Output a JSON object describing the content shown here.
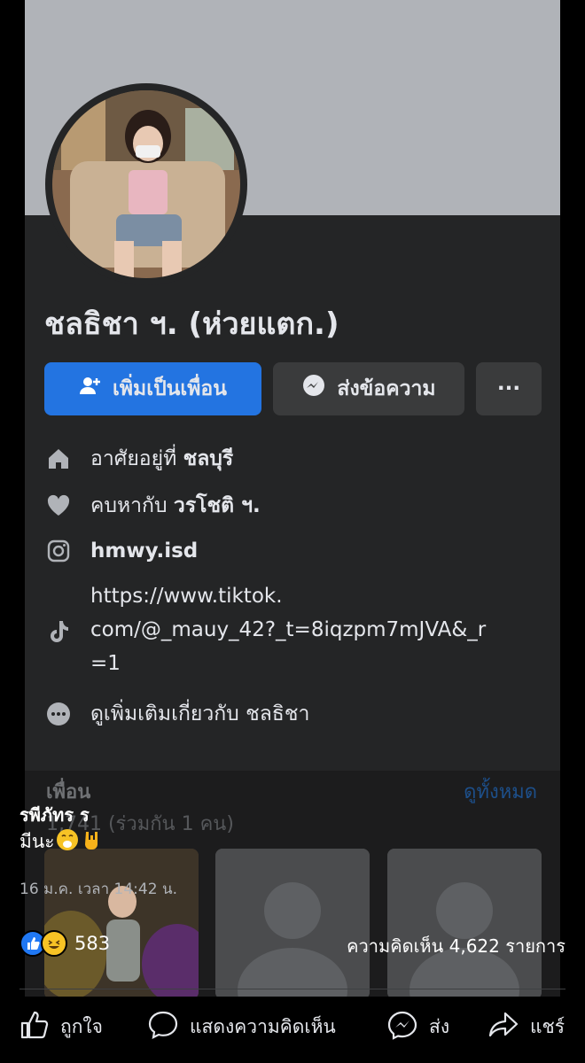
{
  "profile": {
    "name": "ชลธิชา ฯ. (ห่วยแตก.)",
    "add_friend_label": "เพิ่มเป็นเพื่อน",
    "message_label": "ส่งข้อความ",
    "more_label": "···"
  },
  "intro": {
    "lives_in_prefix": "อาศัยอยู่ที่",
    "lives_in_value": "ชลบุรี",
    "relationship_prefix": "คบหากับ",
    "relationship_value": "วรโชติ ฯ.",
    "instagram": "hmwy.isd",
    "tiktok_line1": "https://www.tiktok.",
    "tiktok_line2": "com/@_mauy_42?_t=8iqzpm7mJVA&_r",
    "tiktok_line3": "=1",
    "see_more": "ดูเพิ่มเติมเกี่ยวกับ ชลธิชา"
  },
  "friends": {
    "title": "เพื่อน",
    "see_all": "ดูทั้งหมด",
    "count": "1,741 (ร่วมกัน 1 คน)"
  },
  "post": {
    "author": "รพีภัทร ร",
    "text": "มีนะ",
    "date": "16 ม.ค. เวลา 14:42 น.",
    "reaction_count": "583",
    "comments": "ความคิดเห็น 4,622 รายการ"
  },
  "actions": {
    "like": "ถูกใจ",
    "comment": "แสดงความคิดเห็น",
    "send": "ส่ง",
    "share": "แชร์"
  },
  "colors": {
    "primary_button": "#2374e1",
    "secondary_button": "#3a3b3c",
    "panel_bg": "#242526",
    "cover": "#b0b3b8"
  }
}
